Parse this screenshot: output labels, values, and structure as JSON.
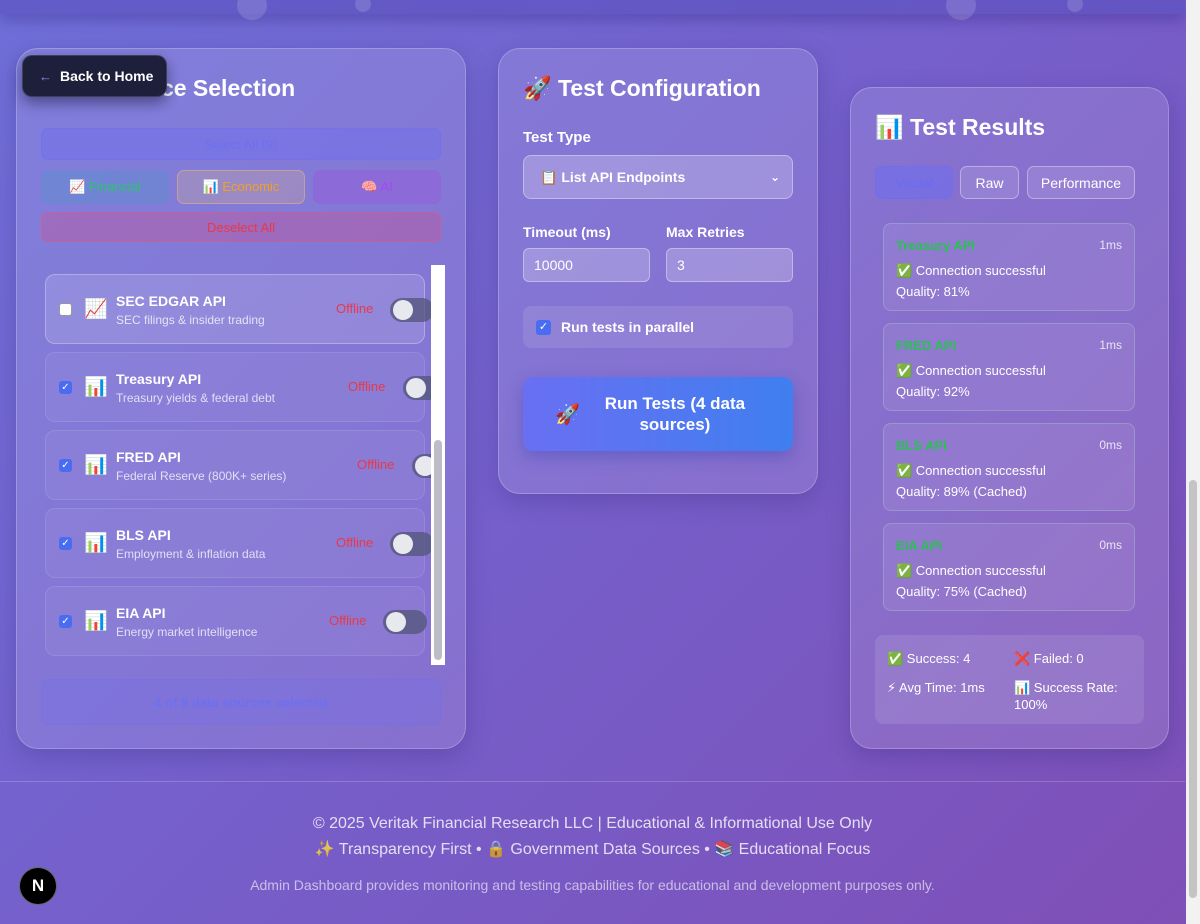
{
  "nav": {
    "back_label": "Back to Home",
    "back_icon": "arrow-left-icon"
  },
  "sources": {
    "title": "rce Selection",
    "filters": {
      "select_all": "Select All (9)",
      "financial": "📈 Financial",
      "economic": "📊 Economic",
      "ai": "🧠 AI",
      "deselect_all": "Deselect All"
    },
    "items": [
      {
        "name": "SEC EDGAR API",
        "desc": "SEC filings & insider trading",
        "status": "Offline",
        "checked": false,
        "icon": "📈"
      },
      {
        "name": "Treasury API",
        "desc": "Treasury yields & federal debt",
        "status": "Offline",
        "checked": true,
        "icon": "📊"
      },
      {
        "name": "FRED API",
        "desc": "Federal Reserve (800K+ series)",
        "status": "Offline",
        "checked": true,
        "icon": "📊"
      },
      {
        "name": "BLS API",
        "desc": "Employment & inflation data",
        "status": "Offline",
        "checked": true,
        "icon": "📊"
      },
      {
        "name": "EIA API",
        "desc": "Energy market intelligence",
        "status": "Offline",
        "checked": true,
        "icon": "📊"
      }
    ],
    "selected_count": "4 of 9 data sources selected"
  },
  "config": {
    "title": "🚀 Test Configuration",
    "test_type_label": "Test Type",
    "test_type_value": "📋 List API Endpoints",
    "timeout_label": "Timeout (ms)",
    "timeout_value": "10000",
    "retries_label": "Max Retries",
    "retries_value": "3",
    "parallel_label": "Run tests in parallel",
    "run_icon": "🚀",
    "run_label": "Run Tests (4 data sources)"
  },
  "results": {
    "title": "📊 Test Results",
    "tabs": [
      "Visual",
      "Raw",
      "Performance"
    ],
    "items": [
      {
        "name": "Treasury API",
        "time": "1ms",
        "message": "✅ Connection successful",
        "quality": "Quality: 81%"
      },
      {
        "name": "FRED API",
        "time": "1ms",
        "message": "✅ Connection successful",
        "quality": "Quality: 92%"
      },
      {
        "name": "BLS API",
        "time": "0ms",
        "message": "✅ Connection successful",
        "quality": "Quality: 89% (Cached)"
      },
      {
        "name": "EIA API",
        "time": "0ms",
        "message": "✅ Connection successful",
        "quality": "Quality: 75% (Cached)"
      }
    ],
    "summary": {
      "success": "✅ Success: 4",
      "failed": "❌ Failed: 0",
      "avg_time": "⚡ Avg Time: 1ms",
      "success_rate": "📊 Success Rate: 100%"
    }
  },
  "footer": {
    "copyright": "© 2025 Veritak Financial Research LLC | Educational & Informational Use Only",
    "tagline": "✨ Transparency First • 🔒 Government Data Sources • 📚 Educational Focus",
    "note": "Admin Dashboard provides monitoring and testing capabilities for educational and development purposes only.",
    "badge": "N"
  },
  "colors": {
    "accent": "#4a6cf0",
    "success": "#27c24f",
    "offline": "#e8394a",
    "dark_button": "#1e1f3b"
  }
}
